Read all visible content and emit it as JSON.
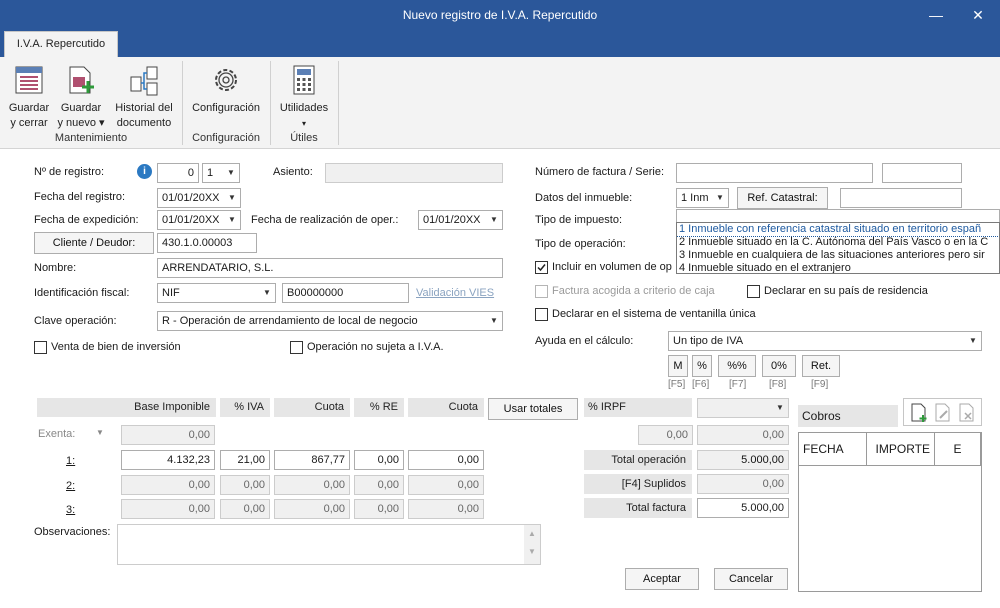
{
  "window": {
    "title": "Nuevo registro de I.V.A. Repercutido",
    "minimize": "—",
    "close": "✕",
    "tab": "I.V.A. Repercutido"
  },
  "ribbon": {
    "save_close_1": "Guardar",
    "save_close_2": "y cerrar",
    "save_new_1": "Guardar",
    "save_new_2": "y nuevo ▾",
    "history_1": "Historial del",
    "history_2": "documento",
    "config": "Configuración",
    "utilities": "Utilidades",
    "utilities_arrow": "▾",
    "group_mantenimiento": "Mantenimiento",
    "group_configuracion": "Configuración",
    "group_utiles": "Útiles"
  },
  "form": {
    "num_registro_label": "Nº de registro:",
    "num_registro_value": "0",
    "num_registro_serie": "1",
    "asiento_label": "Asiento:",
    "fecha_registro_label": "Fecha del registro:",
    "fecha_registro": "01/01/20XX",
    "fecha_expedicion_label": "Fecha de expedición:",
    "fecha_expedicion": "01/01/20XX",
    "fecha_realizacion_label": "Fecha de realización de oper.:",
    "fecha_realizacion": "01/01/20XX",
    "cliente_button": "Cliente / Deudor:",
    "cliente_value": "430.1.0.00003",
    "nombre_label": "Nombre:",
    "nombre_value": "ARRENDATARIO, S.L.",
    "ident_fiscal_label": "Identificación fiscal:",
    "ident_fiscal_tipo": "NIF",
    "ident_fiscal_value": "B00000000",
    "validacion_vies": "Validación VIES",
    "clave_label": "Clave operación:",
    "clave_value": "R - Operación de arrendamiento de local de negocio",
    "venta_bien_inversion": "Venta de bien de inversión",
    "operacion_no_sujeta": "Operación no sujeta a I.V.A.",
    "num_factura_label": "Número de factura / Serie:",
    "datos_inmueble_label": "Datos del inmueble:",
    "datos_inmueble_value": "1 Inm",
    "ref_catastral_button": "Ref. Catastral:",
    "tipo_impuesto_label": "Tipo de impuesto:",
    "tipo_operacion_label": "Tipo de operación:",
    "incluir_volumen_label": "Incluir en volumen de op",
    "factura_caja_label": "Factura acogida a criterio de caja",
    "declarar_pais_label": "Declarar en su país de residencia",
    "ventanilla_label": "Declarar en el sistema de ventanilla única",
    "ayuda_label": "Ayuda en el cálculo:",
    "ayuda_value": "Un tipo de IVA",
    "calc_buttons": [
      "M",
      "%",
      "%%",
      "0%",
      "Ret."
    ],
    "calc_keys": [
      "[F5]",
      "[F6]",
      "[F7]",
      "[F8]",
      "[F9]"
    ]
  },
  "inmueble_options": [
    "1 Inmueble con referencia catastral situado en territorio españ",
    "2 Inmueble situado en la C. Autónoma del País Vasco o en la C",
    "3 Inmueble en cualquiera de las situaciones anteriores pero sir",
    "4 Inmueble situado en el extranjero"
  ],
  "table": {
    "headers": [
      "Base Imponible",
      "% IVA",
      "Cuota",
      "% RE",
      "Cuota"
    ],
    "usar_totales": "Usar totales",
    "irpf_label": "% IRPF",
    "exenta_label": "Exenta:",
    "exenta_base": "0,00",
    "rows": [
      {
        "label": "1:",
        "base": "4.132,23",
        "iva": "21,00",
        "cuota": "867,77",
        "re": "0,00",
        "cuota_re": "0,00"
      },
      {
        "label": "2:",
        "base": "0,00",
        "iva": "0,00",
        "cuota": "0,00",
        "re": "0,00",
        "cuota_re": "0,00"
      },
      {
        "label": "3:",
        "base": "0,00",
        "iva": "0,00",
        "cuota": "0,00",
        "re": "0,00",
        "cuota_re": "0,00"
      }
    ],
    "irpf_pct": "0,00",
    "irpf_value": "0,00",
    "total_operacion_label": "Total operación",
    "total_operacion": "5.000,00",
    "suplidos_label": "[F4] Suplidos",
    "suplidos": "0,00",
    "total_factura_label": "Total factura",
    "total_factura": "5.000,00"
  },
  "cobros": {
    "label": "Cobros",
    "columns": [
      "FECHA",
      "IMPORTE",
      "E"
    ]
  },
  "observaciones_label": "Observaciones:",
  "footer": {
    "aceptar": "Aceptar",
    "cancelar": "Cancelar"
  }
}
